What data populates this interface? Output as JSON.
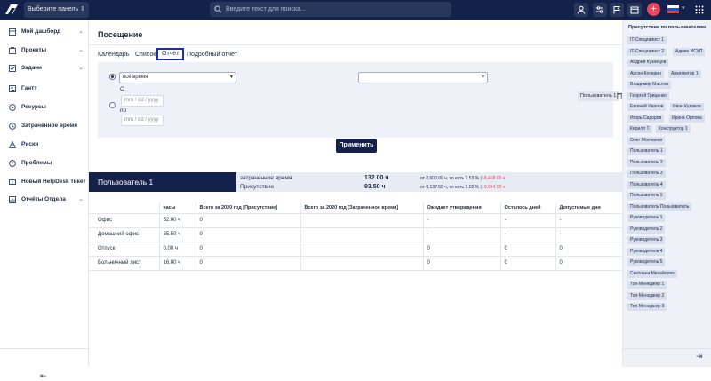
{
  "topbar": {
    "panel_select": "Выберите панель",
    "search_placeholder": "Введите текст для поиска...",
    "colors": {
      "bg": "#14214a",
      "accent": "#e84560"
    },
    "icons": [
      "user-icon",
      "sliders-icon",
      "flag-icon",
      "calendar-icon",
      "mail-icon",
      "plus-icon",
      "grid-icon"
    ]
  },
  "sidebar": {
    "items": [
      {
        "label": "Мой дашборд",
        "icon": "dashboard-icon",
        "chevron": true
      },
      {
        "label": "Проекты",
        "icon": "projects-icon",
        "chevron": true
      },
      {
        "label": "Задачи",
        "icon": "tasks-icon",
        "chevron": true
      },
      {
        "label": "Гантт",
        "icon": "gantt-icon",
        "chevron": false
      },
      {
        "label": "Ресурсы",
        "icon": "resources-icon",
        "chevron": false
      },
      {
        "label": "Затраченное время",
        "icon": "clock-icon",
        "chevron": false
      },
      {
        "label": "Риски",
        "icon": "risk-icon",
        "chevron": false
      },
      {
        "label": "Проблемы",
        "icon": "problem-icon",
        "chevron": false
      },
      {
        "label": "Новый HelpDesk тикет",
        "icon": "ticket-icon",
        "chevron": false
      },
      {
        "label": "Отчёты Отдела",
        "icon": "reports-icon",
        "chevron": true
      }
    ]
  },
  "main": {
    "title": "Посещение",
    "tabs": [
      "Календарь",
      "Список",
      "Отчёт",
      "Подробный отчёт"
    ],
    "active_tab": "Отчёт",
    "filter": {
      "period_select": "всё время",
      "from_label": "С",
      "to_label": "по",
      "date_placeholder": "mm / dd / yyyy",
      "user_select": "",
      "user_chip": "Пользователь 1"
    },
    "apply_label": "Применить",
    "summary": {
      "user": "Пользователь 1",
      "rows": [
        {
          "label": "затраченное время",
          "value": "132.00 ч",
          "note_prefix": "от 8,600.00 ч, то есть 1.53 %",
          "note_sep": "|",
          "note_neg": "-8,468.00 ч"
        },
        {
          "label": "Присутствие",
          "value": "93.50 ч",
          "note_prefix": "от 9,137.50 ч, то есть 1.02 %",
          "note_sep": "|",
          "note_neg": "-9,044.00 ч"
        }
      ]
    },
    "table": {
      "headers": [
        "",
        "часы",
        "Всего за 2020 год [Присутствие]",
        "Всего за 2020 год [Затраченное время]",
        "Ожидает утверждения",
        "Осталось дней",
        "Допустимые дни"
      ],
      "rows": [
        [
          "Офис",
          "52.00 ч",
          "0",
          "",
          "-",
          "-",
          "-"
        ],
        [
          "Домашний офис",
          "25.50 ч",
          "0",
          "",
          "-",
          "-",
          "-"
        ],
        [
          "Отпуск",
          "0.00 ч",
          "0",
          "",
          "0",
          "0",
          "0"
        ],
        [
          "Больничный лист",
          "16.00 ч",
          "0",
          "",
          "0",
          "0",
          "0"
        ]
      ]
    }
  },
  "right_panel": {
    "title": "Присутствие по пользователям",
    "chips": [
      "IT-Специалист 1",
      "IT-Специалист 2",
      "Админ ИСУП",
      "Андрей Кузнецов",
      "Арсен Кочерин",
      "Архитектор 1",
      "Владимир Маслов",
      "Георгий Гриценко",
      "Евгений Иванов",
      "Иван Куликов",
      "Игорь Сидоров",
      "Ирина Орлова",
      "Кирилл Т.",
      "Конструктор 1",
      "Олег Молчанов",
      "Пользователь 1",
      "Пользователь 2",
      "Пользователь 3",
      "Пользователь 4",
      "Пользователь 5",
      "Пользователь Пользователь",
      "Руководитель 1",
      "Руководитель 2",
      "Руководитель 3",
      "Руководитель 4",
      "Руководитель 5",
      "Светлана Михайлова",
      "Топ-Менеджер 1",
      "Топ-Менеджер 2",
      "Топ-Менеджер 3"
    ]
  }
}
